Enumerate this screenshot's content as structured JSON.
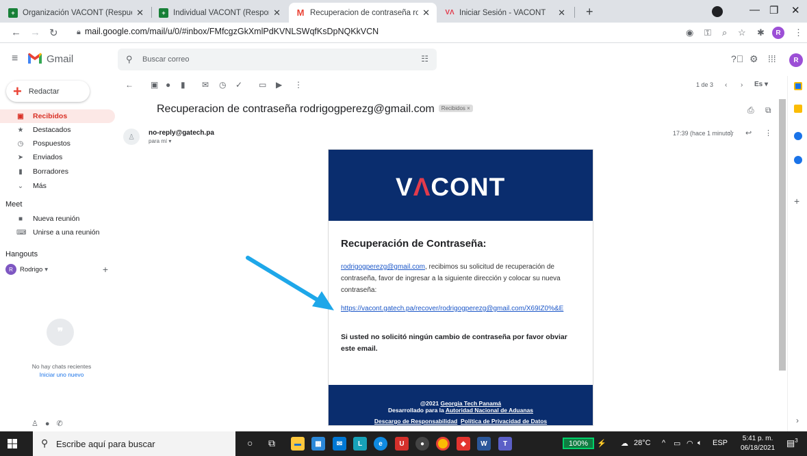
{
  "browser": {
    "tabs": [
      {
        "label": "Organización VACONT (Respuest",
        "favicon": "sheets-icon",
        "color": "#188038"
      },
      {
        "label": "Individual VACONT (Responses) -",
        "favicon": "sheets-icon",
        "color": "#188038"
      },
      {
        "label": "Recuperacion de contraseña rodr",
        "favicon": "gmail-icon",
        "color": "#ea4335"
      },
      {
        "label": "Iniciar Sesión - VACONT",
        "favicon": "vacont-icon",
        "color": "#e23b4c"
      }
    ],
    "url": "mail.google.com/mail/u/0/#inbox/FMfcgzGkXmlPdKVNLSWqfKsDpNQKkVCN",
    "profile_initial": "R"
  },
  "gmail": {
    "app_name": "Gmail",
    "search_placeholder": "Buscar correo",
    "compose_label": "Redactar",
    "nav": [
      {
        "label": "Recibidos",
        "icon": "inbox-icon",
        "active": true
      },
      {
        "label": "Destacados",
        "icon": "star-icon"
      },
      {
        "label": "Pospuestos",
        "icon": "clock-icon"
      },
      {
        "label": "Enviados",
        "icon": "send-icon"
      },
      {
        "label": "Borradores",
        "icon": "draft-icon"
      },
      {
        "label": "Más",
        "icon": "chevron-down-icon"
      }
    ],
    "meet": {
      "heading": "Meet",
      "items": [
        {
          "label": "Nueva reunión",
          "icon": "video-icon"
        },
        {
          "label": "Unirse a una reunión",
          "icon": "keyboard-icon"
        }
      ]
    },
    "hangouts": {
      "heading": "Hangouts",
      "user": "Rodrigo",
      "user_initial": "R",
      "no_chats": "No hay chats recientes",
      "start_new": "Iniciar uno nuevo"
    },
    "pager": "1 de 3",
    "lang": "Es"
  },
  "message": {
    "subject": "Recuperacion de contraseña rodrigogperezg@gmail.com",
    "label_chip": "Recibidos ×",
    "sender": "no-reply@gatech.pa",
    "to": "para mí ▾",
    "time": "17:39 (hace 1 minuto)"
  },
  "email": {
    "brand": {
      "prefix": "V",
      "accent": "Λ",
      "rest": "CONT"
    },
    "heading": "Recuperación de Contraseña:",
    "recipient_link": "rodrigogperezg@gmail.com",
    "body_text": ", recibimos su solicitud de recuperación de contraseña, favor de ingresar a la siguiente dirección y colocar su nueva contraseña:",
    "recover_url": "https://vacont.gatech.pa/recover/rodrigogperezg@gmail.com/X69IZ0%&E",
    "notice": "Si usted no solicitó ningún cambio de contraseña por favor obviar este email.",
    "footer": {
      "copyright_prefix": "@2021 ",
      "company": "Georgia Tech Panamá",
      "dev_prefix": "Desarrollado para la ",
      "client": "Autoridad Nacional de Aduanas",
      "disclaimer": "Descargo de Responsabilidad",
      "privacy": "Política de Privacidad de Datos"
    },
    "colors": {
      "navy": "#0a2d6e",
      "red": "#e23b4c",
      "link": "#1a56c8"
    }
  },
  "taskbar": {
    "search_placeholder": "Escribe aquí para buscar",
    "zoom": "100%",
    "weather": "28°C",
    "lang": "ESP",
    "time": "5:41 p. m.",
    "date": "06/18/2021",
    "notif_count": "3"
  }
}
